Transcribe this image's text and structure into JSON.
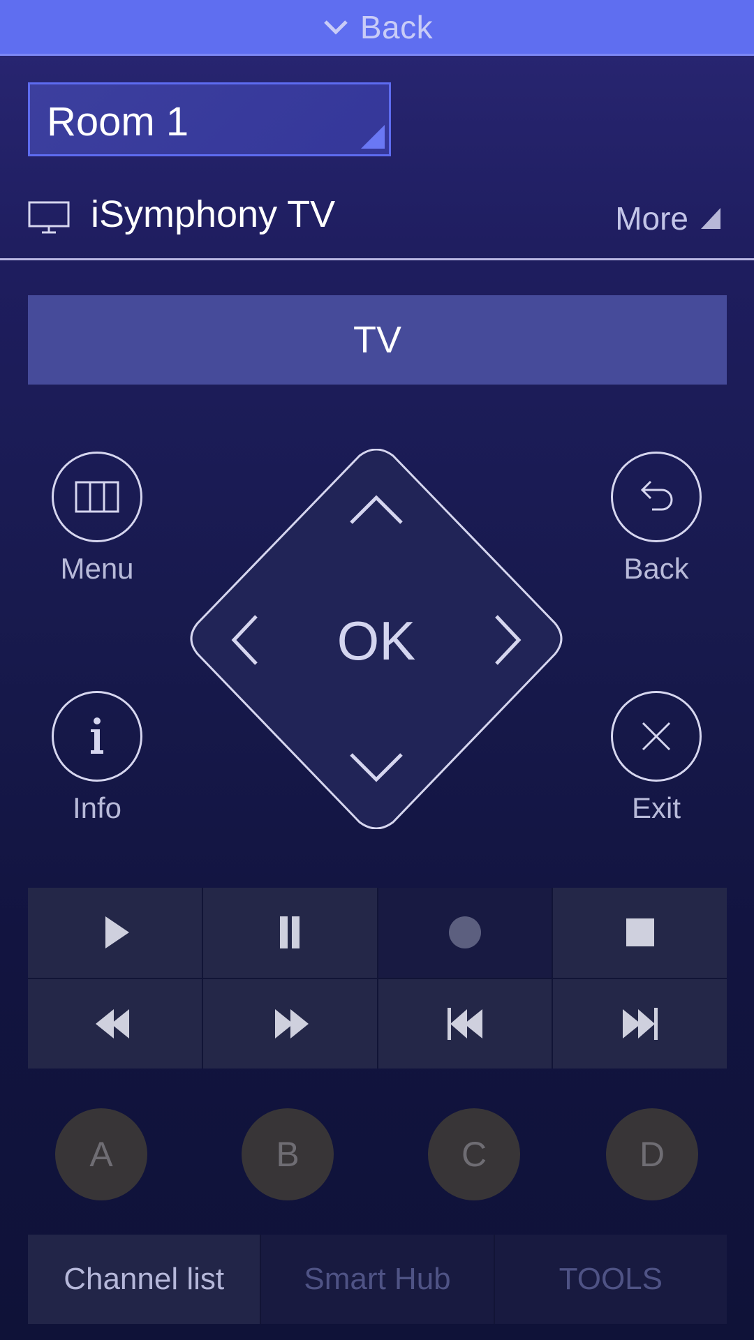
{
  "topbar": {
    "back_label": "Back",
    "icon": "chevron-down-icon"
  },
  "room_selector": {
    "value": "Room 1",
    "icon": "dropdown-corner-icon"
  },
  "device": {
    "name": "iSymphony TV",
    "icon": "tv-monitor-icon",
    "more_label": "More",
    "more_icon": "triangle-corner-icon"
  },
  "source": {
    "label": "TV"
  },
  "nav_buttons": {
    "menu": {
      "label": "Menu",
      "icon": "menu-grid-icon"
    },
    "back": {
      "label": "Back",
      "icon": "return-arrow-icon"
    },
    "info": {
      "label": "Info",
      "icon": "info-icon"
    },
    "exit": {
      "label": "Exit",
      "icon": "close-icon"
    }
  },
  "dpad": {
    "ok_label": "OK",
    "up_icon": "chevron-up-icon",
    "down_icon": "chevron-down-icon",
    "left_icon": "chevron-left-icon",
    "right_icon": "chevron-right-icon"
  },
  "media_controls": [
    {
      "name": "play",
      "icon": "play-icon"
    },
    {
      "name": "pause",
      "icon": "pause-icon"
    },
    {
      "name": "record",
      "icon": "record-icon"
    },
    {
      "name": "stop",
      "icon": "stop-icon"
    },
    {
      "name": "rewind",
      "icon": "rewind-icon"
    },
    {
      "name": "fast-forward",
      "icon": "fast-forward-icon"
    },
    {
      "name": "skip-previous",
      "icon": "skip-previous-icon"
    },
    {
      "name": "skip-next",
      "icon": "skip-next-icon"
    }
  ],
  "color_buttons": [
    "A",
    "B",
    "C",
    "D"
  ],
  "bottom_tabs": [
    {
      "label": "Channel list",
      "active": true
    },
    {
      "label": "Smart Hub",
      "active": false
    },
    {
      "label": "TOOLS",
      "active": false
    }
  ],
  "colors": {
    "accent": "#5f6ef0",
    "background": "#1b1c55",
    "source_button": "#464b9a",
    "color_button": "#383537"
  }
}
